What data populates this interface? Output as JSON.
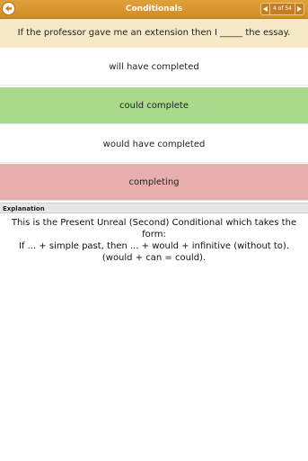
{
  "header": {
    "title": "Conditionals",
    "back_icon": "arrow-left-icon",
    "pager": {
      "prev_icon": "triangle-left-icon",
      "next_icon": "triangle-right-icon",
      "count": "4 of 54"
    }
  },
  "question": {
    "text": "If the professor gave me an extension then I _____ the essay."
  },
  "options": [
    {
      "label": "will have completed"
    },
    {
      "label": "could complete"
    },
    {
      "label": "would have completed"
    },
    {
      "label": "completing"
    }
  ],
  "explanation": {
    "header": "Explanation",
    "line1": "This is the Present Unreal (Second) Conditional which takes the form:",
    "line2": "If ... + simple past, then ... + would + infinitive (without to).  (would + can = could)."
  },
  "colors": {
    "header": "#d8962d",
    "question_bg": "#f6e9c5",
    "correct": "#a9d98b",
    "incorrect": "#e7aeae"
  }
}
